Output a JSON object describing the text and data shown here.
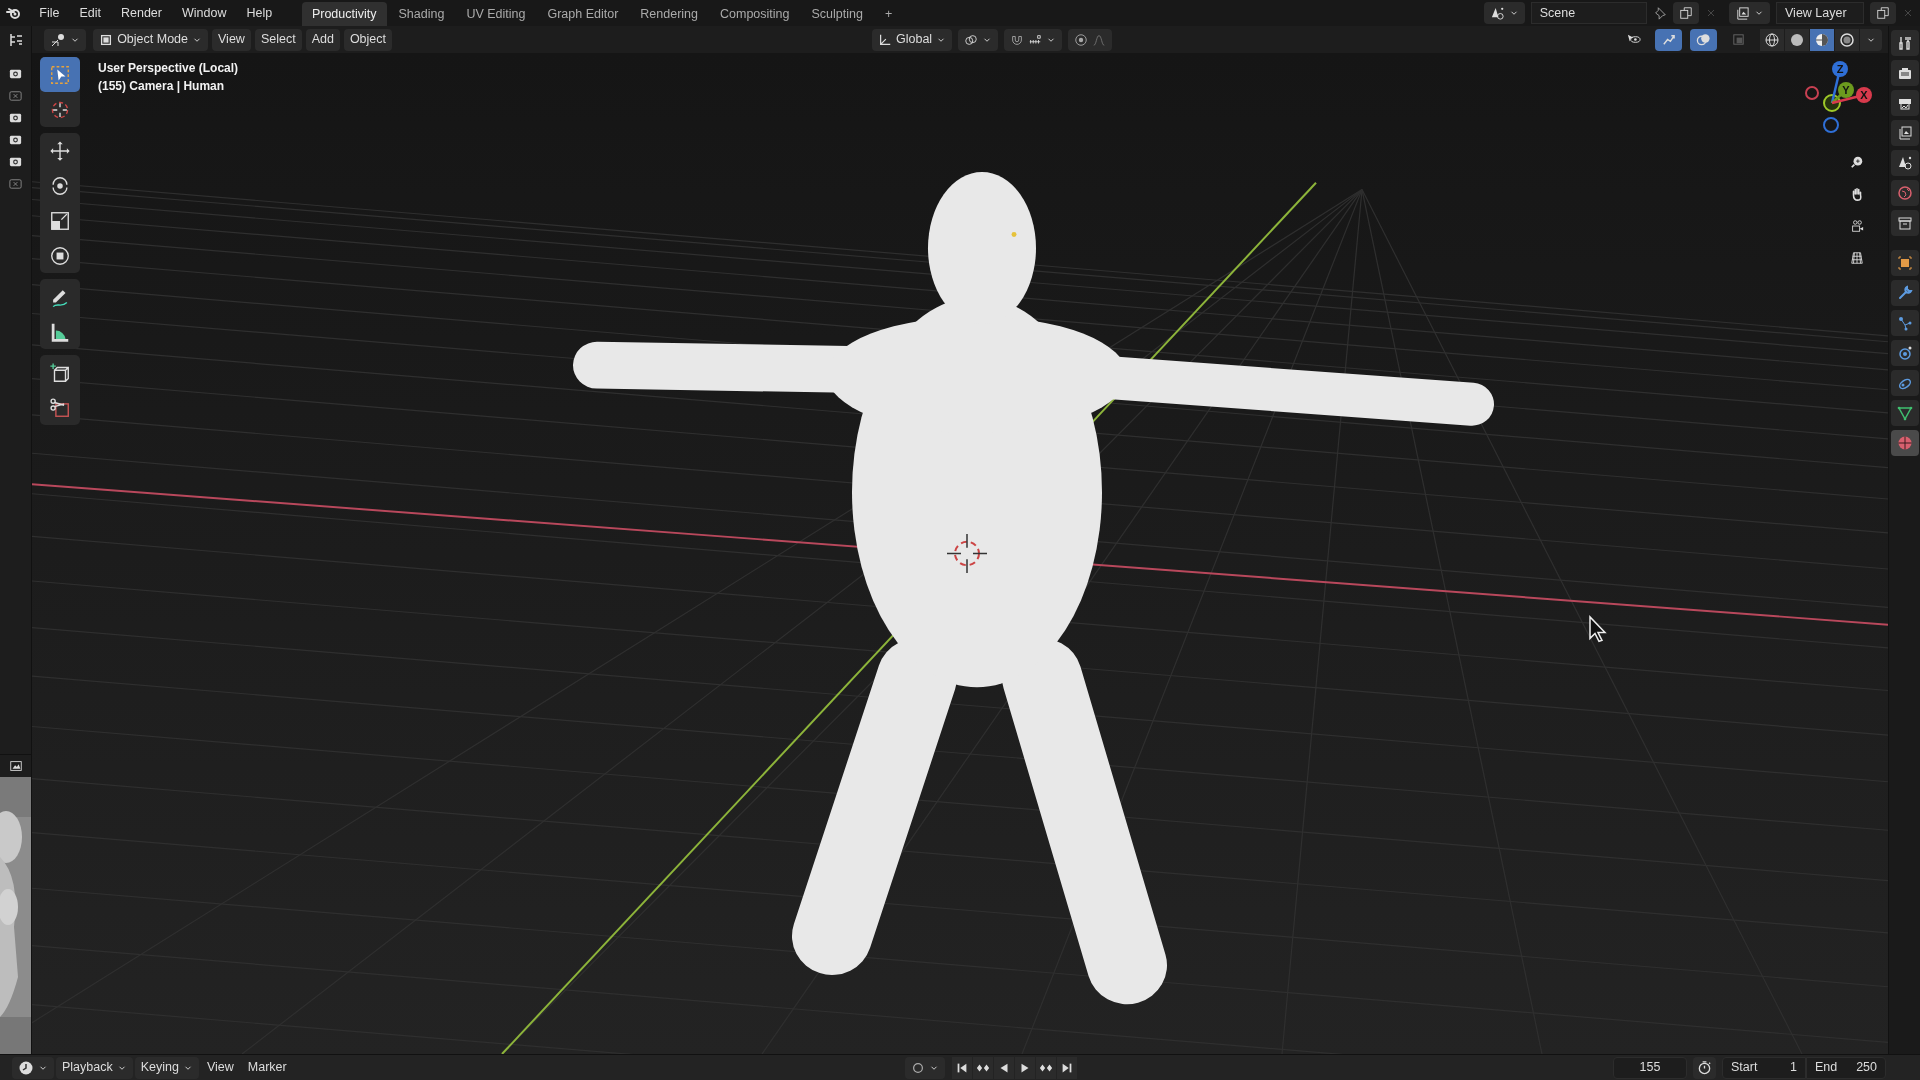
{
  "menu": [
    "File",
    "Edit",
    "Render",
    "Window",
    "Help"
  ],
  "workspace_tabs": [
    {
      "label": "Productivity",
      "selected": true
    },
    {
      "label": "Shading",
      "selected": false
    },
    {
      "label": "UV Editing",
      "selected": false
    },
    {
      "label": "Graph Editor",
      "selected": false
    },
    {
      "label": "Rendering",
      "selected": false
    },
    {
      "label": "Compositing",
      "selected": false
    },
    {
      "label": "Sculpting",
      "selected": false
    },
    {
      "label": "+",
      "selected": false
    }
  ],
  "scene": {
    "value": "Scene"
  },
  "view_layer": {
    "value": "View Layer"
  },
  "viewport_header": {
    "mode": "Object Mode",
    "menus": [
      "View",
      "Select",
      "Add",
      "Object"
    ],
    "orientation": "Global",
    "snap": {
      "on": false
    },
    "proportional_editing": {
      "on": false
    },
    "toggles": [
      {
        "kind": "selectability",
        "on": false
      },
      {
        "kind": "gizmos",
        "on": true
      },
      {
        "kind": "overlays",
        "on": true
      },
      {
        "kind": "xray",
        "on": false
      }
    ],
    "shading_modes": [
      {
        "kind": "wireframe",
        "selected": false
      },
      {
        "kind": "solid",
        "selected": false
      },
      {
        "kind": "material",
        "selected": true
      },
      {
        "kind": "rendered",
        "selected": false
      }
    ]
  },
  "render_slots": [
    {
      "enabled": true
    },
    {
      "enabled": false
    },
    {
      "enabled": true
    },
    {
      "enabled": true
    },
    {
      "enabled": true
    },
    {
      "enabled": false
    }
  ],
  "toolbar": [
    {
      "tools": [
        {
          "kind": "select_box",
          "selected": true
        },
        {
          "kind": "cursor",
          "selected": false
        }
      ]
    },
    {
      "tools": [
        {
          "kind": "move",
          "selected": false
        },
        {
          "kind": "rotate",
          "selected": false
        },
        {
          "kind": "scale",
          "selected": false
        },
        {
          "kind": "transform",
          "selected": false
        }
      ]
    },
    {
      "tools": [
        {
          "kind": "annotate",
          "selected": false
        },
        {
          "kind": "measure",
          "selected": false
        }
      ]
    },
    {
      "tools": [
        {
          "kind": "add_cube",
          "selected": false
        },
        {
          "kind": "cut",
          "selected": false
        }
      ]
    }
  ],
  "viewport_overlay": {
    "view_name": "User Perspective (Local)",
    "object_info": "(155) Camera | Human"
  },
  "gizmo_axes": [
    {
      "label": "Z"
    },
    {
      "label": "Y"
    },
    {
      "label": "X"
    }
  ],
  "navigation": [
    {
      "kind": "zoom"
    },
    {
      "kind": "pan"
    },
    {
      "kind": "camera"
    },
    {
      "kind": "ortho"
    }
  ],
  "properties_tabs": [
    {
      "kind": "tool",
      "selected": false
    },
    {
      "kind": "render",
      "selected": false
    },
    {
      "kind": "output",
      "selected": false
    },
    {
      "kind": "view_layer",
      "selected": false
    },
    {
      "kind": "scene",
      "selected": false
    },
    {
      "kind": "world",
      "selected": false
    },
    {
      "kind": "collection",
      "selected": false
    },
    {
      "kind": "object",
      "selected": false
    },
    {
      "kind": "modifier",
      "selected": false
    },
    {
      "kind": "particles",
      "selected": false
    },
    {
      "kind": "physics",
      "selected": false
    },
    {
      "kind": "constraints",
      "selected": false
    },
    {
      "kind": "data",
      "selected": false
    },
    {
      "kind": "material",
      "selected": true
    }
  ],
  "timeline": {
    "menus": [
      {
        "label": "Playback",
        "kind": "dropdown"
      },
      {
        "label": "Keying",
        "kind": "dropdown"
      },
      {
        "label": "View",
        "kind": "menu"
      },
      {
        "label": "Marker",
        "kind": "menu"
      }
    ],
    "auto_keying": {
      "on": false
    },
    "transport": [
      {
        "kind": "jump_start"
      },
      {
        "kind": "prev_key"
      },
      {
        "kind": "play_reverse"
      },
      {
        "kind": "play"
      },
      {
        "kind": "next_key"
      },
      {
        "kind": "jump_end"
      }
    ],
    "current_frame": "155",
    "use_preview_range": {
      "on": false
    },
    "start_label": "Start",
    "start": "1",
    "end_label": "End",
    "end": "250"
  }
}
